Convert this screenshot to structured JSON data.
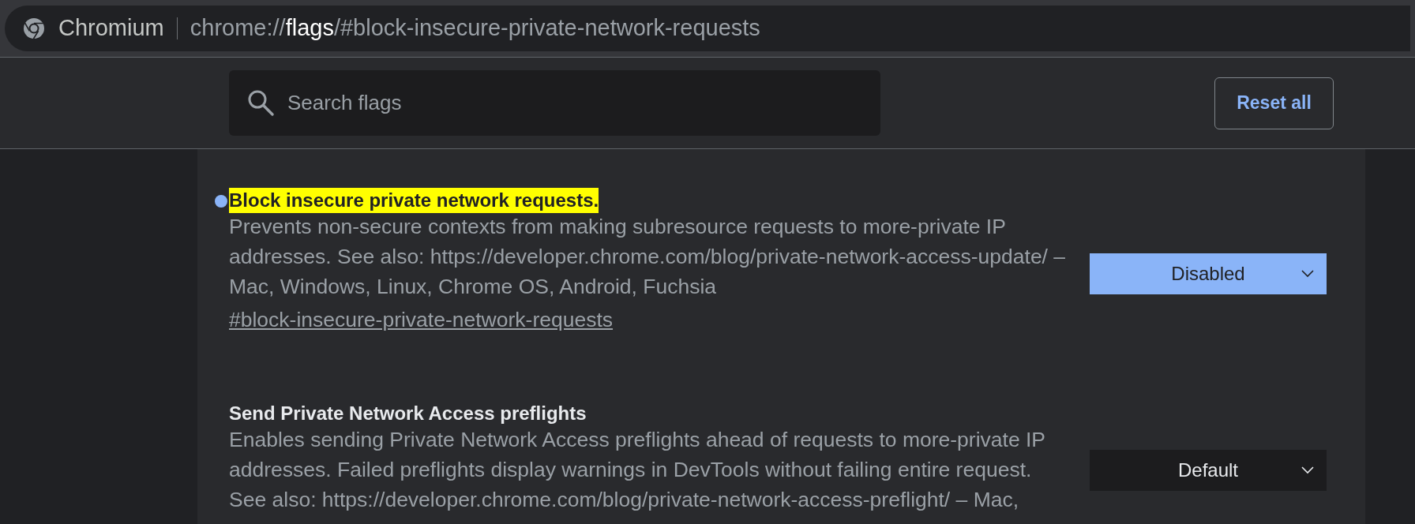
{
  "address_bar": {
    "site_label": "Chromium",
    "url": {
      "scheme": "chrome://",
      "host": "flags",
      "path": "/#block-insecure-private-network-requests"
    }
  },
  "search": {
    "placeholder": "Search flags"
  },
  "reset_button": "Reset all",
  "flags": [
    {
      "title": "Block insecure private network requests.",
      "highlighted": true,
      "modified": true,
      "description": "Prevents non-secure contexts from making subresource requests to more-private IP addresses. See also: https://developer.chrome.com/blog/private-network-access-update/ – Mac, Windows, Linux, Chrome OS, Android, Fuchsia",
      "link": "#block-insecure-private-network-requests",
      "value": "Disabled"
    },
    {
      "title": "Send Private Network Access preflights",
      "highlighted": false,
      "modified": false,
      "description": "Enables sending Private Network Access preflights ahead of requests to more-private IP addresses. Failed preflights display warnings in DevTools without failing entire request. See also: https://developer.chrome.com/blog/private-network-access-preflight/ – Mac,",
      "value": "Default"
    }
  ]
}
